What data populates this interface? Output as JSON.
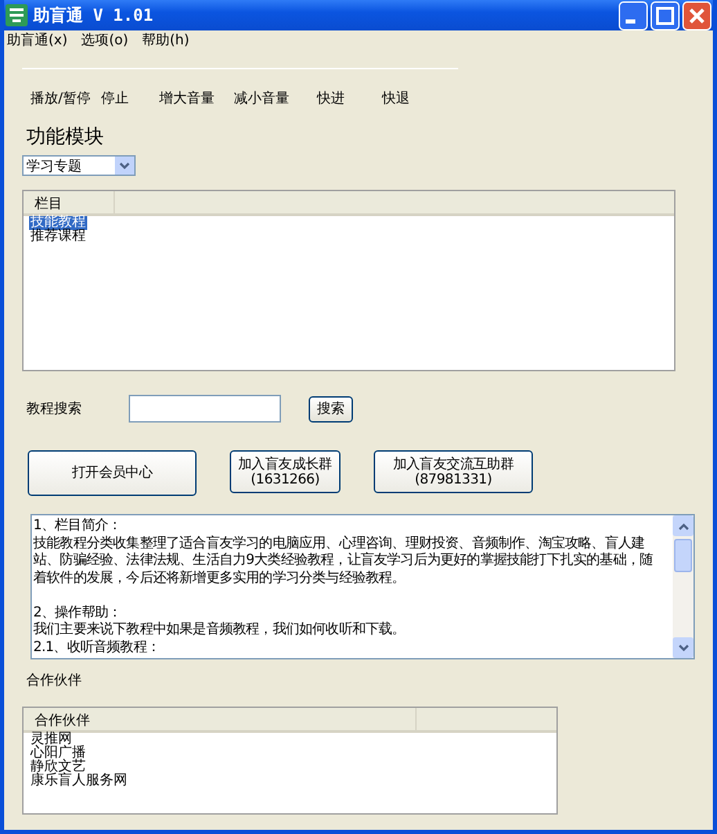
{
  "window": {
    "title": "助盲通 V 1.01"
  },
  "menu": [
    "助盲通(x)",
    "选项(o)",
    "帮助(h)"
  ],
  "media_controls": [
    "播放/暂停",
    "停止",
    "增大音量",
    "减小音量",
    "快进",
    "快退"
  ],
  "module_heading": "功能模块",
  "module_combo": {
    "value": "学习专题"
  },
  "category_list": {
    "column": "栏目",
    "items": [
      {
        "label": "技能教程",
        "selected": true
      },
      {
        "label": "推荐课程",
        "selected": false
      }
    ]
  },
  "search": {
    "label": "教程搜索",
    "button": "搜索"
  },
  "buttons": [
    {
      "label": "打开会员中心"
    },
    {
      "label": "加入盲友成长群",
      "sub": "(1631266)"
    },
    {
      "label": "加入盲友交流互助群",
      "sub": "(87981331)"
    }
  ],
  "info_text": [
    [
      "1、栏目简介：",
      "技能教程分类收集整理了适合盲友学习的电脑应用、心理咨询、理财投资、音频制作、淘宝攻略、盲人建",
      "站、防骗经验、法律法规、生活自力9大类经验教程，让盲友学习后为更好的掌握技能打下扎实的基础，随",
      "着软件的发展，今后还将新增更多实用的学习分类与经验教程。"
    ],
    [
      "2、操作帮助：",
      "我们主要来说下教程中如果是音频教程，我们如何收听和下载。",
      "2.1、收听音频教程："
    ]
  ],
  "partners_label": "合作伙伴",
  "partner_list": {
    "column": "合作伙伴",
    "items": [
      "灵推网",
      "心阳广播",
      "静欣文艺",
      "康乐盲人服务网"
    ]
  }
}
